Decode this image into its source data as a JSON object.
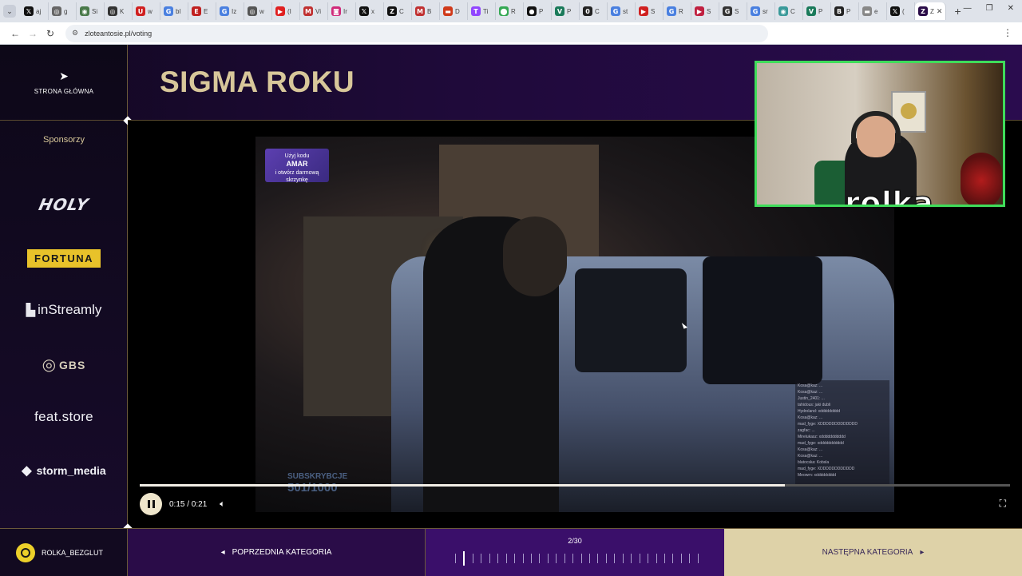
{
  "browser": {
    "tabs": [
      {
        "icon": "x-icon",
        "label": "aj",
        "color": "#111111",
        "glyph": "𝕏"
      },
      {
        "icon": "globe-icon",
        "label": "g",
        "color": "#666666",
        "glyph": "◎"
      },
      {
        "icon": "globe-icon",
        "label": "Si",
        "color": "#4a7a4a",
        "glyph": "◉"
      },
      {
        "icon": "globe-icon",
        "label": "K",
        "color": "#333333",
        "glyph": "◎"
      },
      {
        "icon": "youtube-icon",
        "label": "w",
        "color": "#d02020",
        "glyph": "U"
      },
      {
        "icon": "google-icon",
        "label": "bl",
        "color": "#4a80e0",
        "glyph": "G"
      },
      {
        "icon": "news-icon",
        "label": "E",
        "color": "#c02020",
        "glyph": "E"
      },
      {
        "icon": "google-icon",
        "label": "Iz",
        "color": "#4a80e0",
        "glyph": "G"
      },
      {
        "icon": "globe-icon",
        "label": "w",
        "color": "#555555",
        "glyph": "◎"
      },
      {
        "icon": "youtube-icon",
        "label": "(I",
        "color": "#e02020",
        "glyph": "▶"
      },
      {
        "icon": "gmail-icon",
        "label": "Vi",
        "color": "#c03030",
        "glyph": "M"
      },
      {
        "icon": "instagram-icon",
        "label": "Ir",
        "color": "#d02a7a",
        "glyph": "◙"
      },
      {
        "icon": "x-icon",
        "label": "x",
        "color": "#111111",
        "glyph": "𝕏"
      },
      {
        "icon": "x-icon",
        "label": "C",
        "color": "#111111",
        "glyph": "Z"
      },
      {
        "icon": "gmail-icon",
        "label": "B",
        "color": "#c03030",
        "glyph": "M"
      },
      {
        "icon": "news-icon",
        "label": "D",
        "color": "#d03a1a",
        "glyph": "▬"
      },
      {
        "icon": "twitch-icon",
        "label": "Ti",
        "color": "#9146ff",
        "glyph": "T"
      },
      {
        "icon": "maps-icon",
        "label": "R",
        "color": "#34a853",
        "glyph": "⬤"
      },
      {
        "icon": "globe-icon",
        "label": "P",
        "color": "#111111",
        "glyph": "●"
      },
      {
        "icon": "vp-icon",
        "label": "P",
        "color": "#1a7a5a",
        "glyph": "V"
      },
      {
        "icon": "globe-icon",
        "label": "C",
        "color": "#222222",
        "glyph": "0"
      },
      {
        "icon": "google-icon",
        "label": "st",
        "color": "#4a80e0",
        "glyph": "G"
      },
      {
        "icon": "youtube-icon",
        "label": "S",
        "color": "#d02020",
        "glyph": "▶"
      },
      {
        "icon": "google-icon",
        "label": "R",
        "color": "#4a80e0",
        "glyph": "G"
      },
      {
        "icon": "youtube-icon",
        "label": "S",
        "color": "#c02040",
        "glyph": "▶"
      },
      {
        "icon": "globe-icon",
        "label": "S",
        "color": "#333333",
        "glyph": "G"
      },
      {
        "icon": "google-icon",
        "label": "sr",
        "color": "#4a80e0",
        "glyph": "G"
      },
      {
        "icon": "globe-icon",
        "label": "C",
        "color": "#3a9a9a",
        "glyph": "◉"
      },
      {
        "icon": "vp-icon",
        "label": "P",
        "color": "#1a7a5a",
        "glyph": "V"
      },
      {
        "icon": "globe-icon",
        "label": "P",
        "color": "#222222",
        "glyph": "B"
      },
      {
        "icon": "globe-icon",
        "label": "e",
        "color": "#888888",
        "glyph": "▬"
      },
      {
        "icon": "x-icon",
        "label": "(",
        "color": "#111111",
        "glyph": "𝕏"
      }
    ],
    "active_tab": {
      "label": "Z",
      "close": "✕"
    },
    "new_tab": "+",
    "url": "zloteantosie.pl/voting"
  },
  "sidebar": {
    "home_label": "STRONA GŁÓWNA",
    "sponsors_title": "Sponsorzy",
    "sponsors": {
      "holy": "HOLY",
      "fortuna": "FORTUNA",
      "instreamly": "inStreamly",
      "gbs": "GBS",
      "feat": "feat.store",
      "storm": "storm_media"
    }
  },
  "header": {
    "title": "SIGMA ROKU"
  },
  "video": {
    "promo_lines": [
      "Użyj kodu",
      "AMAR",
      "i otwórz darmową skrzynkę"
    ],
    "chat_lines": [
      "Kosa@kaz: ...",
      "Kosa@kaz: ...",
      "Justin_2401: ...",
      "tahidous: jaki dubli",
      "Hydroland: xddddddddd",
      "Kosa@kaz: ...",
      "mad_fyge: XDDDDDDDDDDDDD",
      "zagfac: ...",
      "Mirelukasz: xddddddddddd",
      "mad_fyge: xddddddddddd",
      "Kosa@kaz: ...",
      "Kosa@kaz: ...",
      "blatocska: Kobsla",
      "mad_fyge: XDDDDDDDDDDDD",
      "Meowrn: xddddddddd"
    ],
    "subs_label": "SUBSKRYBCJE",
    "subs_count": "501/1000",
    "time": "0:15 / 0:21",
    "progress": 0.741
  },
  "webcam": {
    "name": "rolka"
  },
  "footer": {
    "username": "ROLKA_BEZGLUT",
    "prev_label": "POPRZEDNIA KATEGORIA",
    "pager_label": "2/30",
    "current_index": 2,
    "total": 30,
    "next_label": "NASTĘPNA KATEGORIA"
  },
  "colors": {
    "accent_gold": "#d8c79a",
    "next_bg": "#ded2a8",
    "webcam_border": "#3fdc5a",
    "avatar": "#ecd02a"
  }
}
